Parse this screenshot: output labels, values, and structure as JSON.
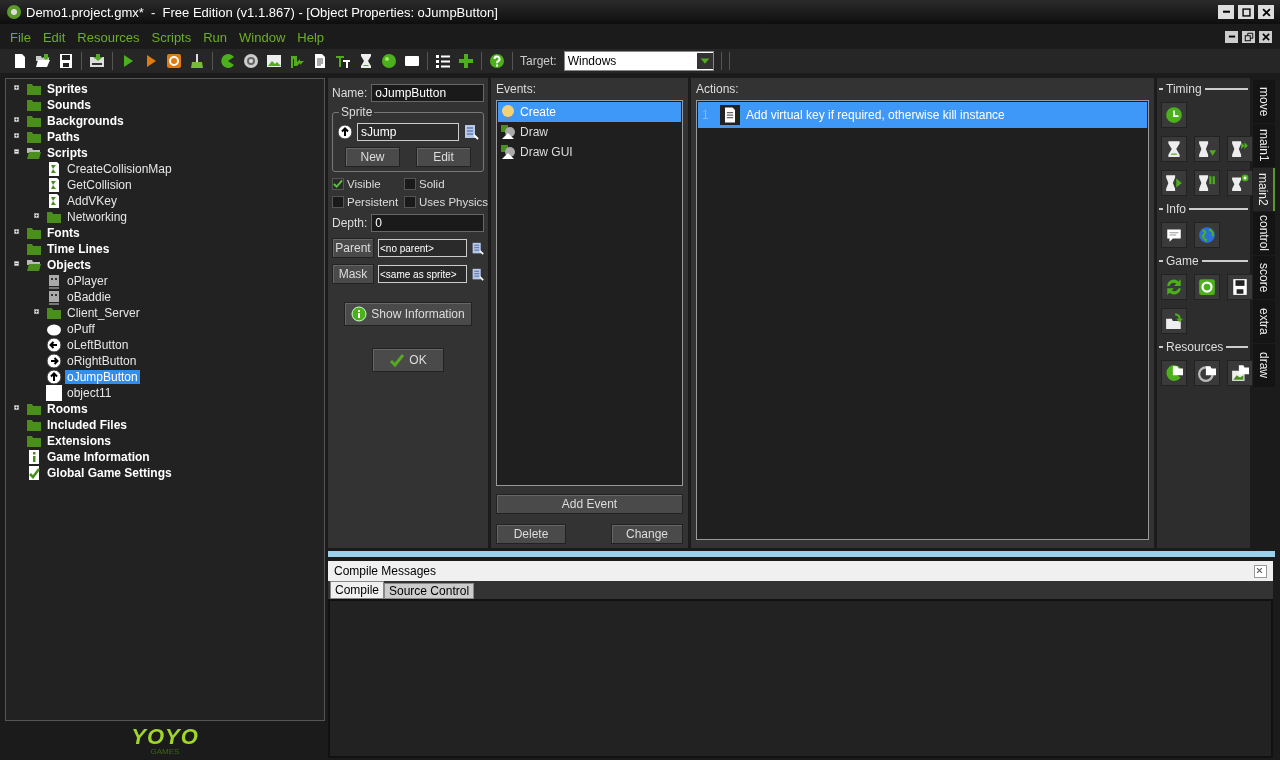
{
  "window": {
    "title": "Demo1.project.gmx*  -  Free Edition (v1.1.867) - [Object Properties: oJumpButton]"
  },
  "menu": [
    "File",
    "Edit",
    "Resources",
    "Scripts",
    "Run",
    "Window",
    "Help"
  ],
  "toolbar": {
    "target_label": "Target:",
    "target_value": "Windows"
  },
  "resource_tree": [
    {
      "label": "Sprites",
      "kind": "folder",
      "expanded": false,
      "empty": false
    },
    {
      "label": "Sounds",
      "kind": "folder",
      "expanded": false,
      "empty": true
    },
    {
      "label": "Backgrounds",
      "kind": "folder",
      "expanded": false,
      "empty": false
    },
    {
      "label": "Paths",
      "kind": "folder",
      "expanded": false,
      "empty": false
    },
    {
      "label": "Scripts",
      "kind": "folder",
      "expanded": true,
      "empty": false,
      "children": [
        {
          "label": "CreateCollisionMap",
          "kind": "script",
          "selected": false
        },
        {
          "label": "GetCollision",
          "kind": "script",
          "selected": false
        },
        {
          "label": "AddVKey",
          "kind": "script",
          "selected": false
        },
        {
          "label": "Networking",
          "kind": "folder",
          "expanded": false,
          "empty": false
        }
      ]
    },
    {
      "label": "Fonts",
      "kind": "folder",
      "expanded": false,
      "empty": false
    },
    {
      "label": "Time Lines",
      "kind": "folder",
      "expanded": false,
      "empty": true
    },
    {
      "label": "Objects",
      "kind": "folder",
      "expanded": true,
      "empty": false,
      "children": [
        {
          "label": "oPlayer",
          "kind": "robot",
          "selected": false
        },
        {
          "label": "oBaddie",
          "kind": "robot",
          "selected": false
        },
        {
          "label": "Client_Server",
          "kind": "folder",
          "expanded": false,
          "empty": false
        },
        {
          "label": "oPuff",
          "kind": "blob",
          "selected": false
        },
        {
          "label": "oLeftButton",
          "kind": "left",
          "selected": false
        },
        {
          "label": "oRightButton",
          "kind": "right",
          "selected": false
        },
        {
          "label": "oJumpButton",
          "kind": "up",
          "selected": true
        },
        {
          "label": "object11",
          "kind": "blank",
          "selected": false
        }
      ]
    },
    {
      "label": "Rooms",
      "kind": "folder",
      "expanded": false,
      "empty": false
    },
    {
      "label": "Included Files",
      "kind": "folder",
      "expanded": false,
      "empty": true
    },
    {
      "label": "Extensions",
      "kind": "folder",
      "expanded": false,
      "empty": true
    },
    {
      "label": "Game Information",
      "kind": "info",
      "selected": false
    },
    {
      "label": "Global Game Settings",
      "kind": "settings",
      "selected": false
    }
  ],
  "logo": {
    "text": "YOYO",
    "subtext": "GAMES"
  },
  "object_properties": {
    "name_label": "Name:",
    "name_value": "oJumpButton",
    "sprite_group": "Sprite",
    "sprite_value": "sJump",
    "new_button": "New",
    "edit_button": "Edit",
    "checkboxes": [
      {
        "label": "Visible",
        "checked": true
      },
      {
        "label": "Solid",
        "checked": false
      },
      {
        "label": "Persistent",
        "checked": false
      },
      {
        "label": "Uses Physics",
        "checked": false
      }
    ],
    "depth_label": "Depth:",
    "depth_value": "0",
    "parent_button": "Parent",
    "parent_value": "<no parent>",
    "mask_button": "Mask",
    "mask_value": "<same as sprite>",
    "info_button": "Show Information",
    "ok_button": "OK"
  },
  "events": {
    "label": "Events:",
    "items": [
      {
        "label": "Create",
        "kind": "create",
        "selected": true
      },
      {
        "label": "Draw",
        "kind": "draw",
        "selected": false
      },
      {
        "label": "Draw GUI",
        "kind": "draw",
        "selected": false
      }
    ],
    "add_button": "Add Event",
    "delete_button": "Delete",
    "change_button": "Change"
  },
  "actions": {
    "label": "Actions:",
    "items": [
      {
        "number": "1",
        "text": "Add virtual key if required, otherwise kill instance",
        "selected": true
      }
    ]
  },
  "palette": {
    "sections": [
      {
        "title": "Timing",
        "kind": "timing"
      },
      {
        "title": "Info",
        "kind": "info"
      },
      {
        "title": "Game",
        "kind": "game"
      },
      {
        "title": "Resources",
        "kind": "resources"
      }
    ],
    "tabs": [
      {
        "label": "move",
        "selected": false
      },
      {
        "label": "main1",
        "selected": false
      },
      {
        "label": "main2",
        "selected": true
      },
      {
        "label": "control",
        "selected": false
      },
      {
        "label": "score",
        "selected": false
      },
      {
        "label": "extra",
        "selected": false
      },
      {
        "label": "draw",
        "selected": false
      }
    ]
  },
  "compile_messages": {
    "title": "Compile Messages",
    "tabs": [
      {
        "label": "Compile",
        "selected": true
      },
      {
        "label": "Source Control",
        "selected": false
      }
    ]
  }
}
